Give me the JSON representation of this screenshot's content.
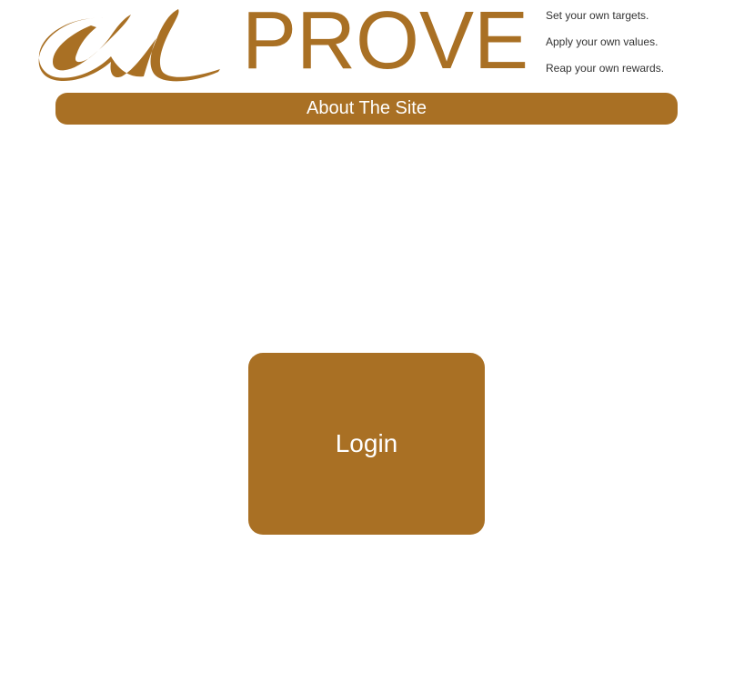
{
  "header": {
    "logo_icon": "script-u-logo-icon",
    "brand": "PROVE",
    "taglines": [
      "Set your own targets.",
      "Apply your own values.",
      "Reap your own rewards."
    ]
  },
  "nav": {
    "about_label": "About The Site"
  },
  "main": {
    "login_label": "Login"
  },
  "colors": {
    "brand": "#a97024",
    "tagline_text": "#333333",
    "button_text": "#ffffff",
    "background": "#ffffff"
  }
}
